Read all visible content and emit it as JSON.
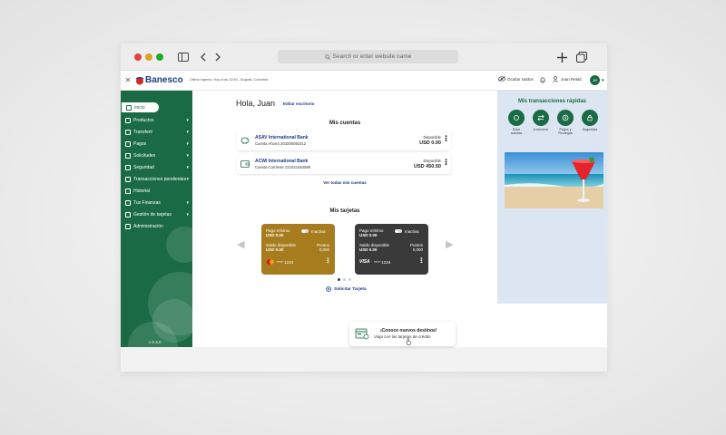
{
  "browser": {
    "search_placeholder": "Search or enter website name"
  },
  "header": {
    "brand": "Banesco",
    "last_login": "Último ingreso: Hoy a las 10:53 - Bogotá, Colombia",
    "hide_balances": "Ocultar saldos",
    "user_name": "Juan Retail",
    "avatar_initials": "JR"
  },
  "sidebar": {
    "items": [
      {
        "label": "Inicio",
        "icon": "home-icon",
        "chevron": ""
      },
      {
        "label": "Productos",
        "icon": "grid-icon",
        "chevron": "▾"
      },
      {
        "label": "Transferir",
        "icon": "transfer-icon",
        "chevron": "▾"
      },
      {
        "label": "Pagos",
        "icon": "payment-icon",
        "chevron": "▾"
      },
      {
        "label": "Solicitudes",
        "icon": "request-icon",
        "chevron": "▾"
      },
      {
        "label": "Seguridad",
        "icon": "shield-icon",
        "chevron": "▾"
      },
      {
        "label": "Transacciones pendientes",
        "icon": "pending-icon",
        "chevron": "▾"
      },
      {
        "label": "Historial",
        "icon": "history-icon",
        "chevron": ""
      },
      {
        "label": "Tus Finanzas",
        "icon": "finance-icon",
        "chevron": "▾"
      },
      {
        "label": "Gestión de tarjetas",
        "icon": "card-icon",
        "chevron": "▾"
      },
      {
        "label": "Administración",
        "icon": "admin-icon",
        "chevron": ""
      }
    ],
    "version": "v 0.3.0"
  },
  "main": {
    "greeting": "Hola, Juan",
    "edit_link": "Editar escritorio",
    "accounts_title": "Mis cuentas",
    "accounts": [
      {
        "bank": "ASAV International Bank",
        "type": "Cuenta Ahorro 201000091012",
        "available_label": "Disponible",
        "balance": "USD 0.00"
      },
      {
        "bank": "ACWI International Bank",
        "type": "Cuenta Corriente 221021464089",
        "available_label": "Disponible",
        "balance": "USD 450.50"
      }
    ],
    "see_all_accounts": "Ver todas mis cuentas",
    "cards_title": "Mis tarjetas",
    "cards": [
      {
        "min_label": "Pago mínimo",
        "min_value": "USD 0.00",
        "status": "Inactiva",
        "balance_label": "Saldo disponible",
        "balance_value": "USD 0.00",
        "points_label": "Puntos",
        "points_value": "0,000",
        "number": "**** 1234",
        "brand": "mastercard",
        "color": "#a67c1e"
      },
      {
        "min_label": "Pago mínimo",
        "min_value": "USD 0.00",
        "status": "Inactiva",
        "balance_label": "Saldo disponible",
        "balance_value": "USD 0.00",
        "points_label": "Puntos",
        "points_value": "0,000",
        "number": "**** 1234",
        "brand": "VISA",
        "color": "#3a3a3a"
      }
    ],
    "request_card": "Solicitar Tarjeta"
  },
  "quick": {
    "title": "Mis transacciones rápidas",
    "items": [
      {
        "label": "Entre cuentas",
        "icon": "between-accounts-icon"
      },
      {
        "label": "A terceros",
        "icon": "third-party-icon"
      },
      {
        "label": "Pagos y Recargas",
        "icon": "payments-recharges-icon"
      },
      {
        "label": "Seguridad",
        "icon": "security-icon"
      }
    ]
  },
  "promo": {
    "title": "¡Conoce nuevos destinos!",
    "subtitle": "Viaja con las tarjetas de crédito"
  },
  "colors": {
    "brand_green": "#1a6b45",
    "brand_blue": "#1d3a8a",
    "brand_red": "#d52b1e",
    "link_blue": "#1d3a8a"
  }
}
